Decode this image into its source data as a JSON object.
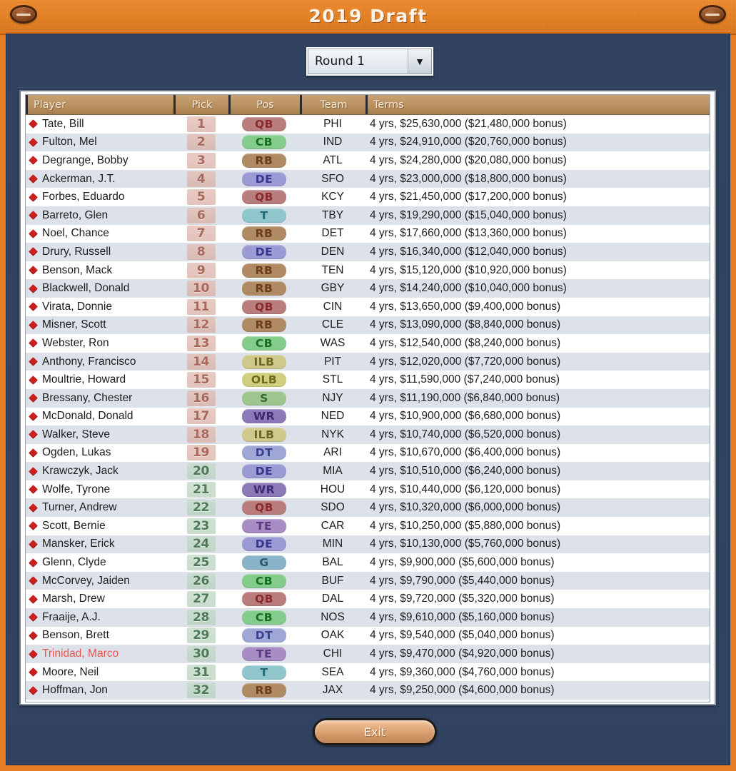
{
  "window": {
    "title": "2019 Draft",
    "minimize_left_icon": "football-icon",
    "minimize_right_icon": "football-icon"
  },
  "round_select": {
    "value": "Round 1",
    "arrow": "▼"
  },
  "table": {
    "columns": [
      "Player",
      "Pick",
      "Pos",
      "Team",
      "Terms"
    ],
    "rows": [
      {
        "player": "Tate, Bill",
        "pick": "1",
        "pos": "QB",
        "team": "PHI",
        "terms": "4 yrs, $25,630,000 ($21,480,000 bonus)",
        "highlight": false
      },
      {
        "player": "Fulton, Mel",
        "pick": "2",
        "pos": "CB",
        "team": "IND",
        "terms": "4 yrs, $24,910,000 ($20,760,000 bonus)",
        "highlight": false
      },
      {
        "player": "Degrange, Bobby",
        "pick": "3",
        "pos": "RB",
        "team": "ATL",
        "terms": "4 yrs, $24,280,000 ($20,080,000 bonus)",
        "highlight": false
      },
      {
        "player": "Ackerman, J.T.",
        "pick": "4",
        "pos": "DE",
        "team": "SFO",
        "terms": "4 yrs, $23,000,000 ($18,800,000 bonus)",
        "highlight": false
      },
      {
        "player": "Forbes, Eduardo",
        "pick": "5",
        "pos": "QB",
        "team": "KCY",
        "terms": "4 yrs, $21,450,000 ($17,200,000 bonus)",
        "highlight": false
      },
      {
        "player": "Barreto, Glen",
        "pick": "6",
        "pos": "T",
        "team": "TBY",
        "terms": "4 yrs, $19,290,000 ($15,040,000 bonus)",
        "highlight": false
      },
      {
        "player": "Noel, Chance",
        "pick": "7",
        "pos": "RB",
        "team": "DET",
        "terms": "4 yrs, $17,660,000 ($13,360,000 bonus)",
        "highlight": false
      },
      {
        "player": "Drury, Russell",
        "pick": "8",
        "pos": "DE",
        "team": "DEN",
        "terms": "4 yrs, $16,340,000 ($12,040,000 bonus)",
        "highlight": false
      },
      {
        "player": "Benson, Mack",
        "pick": "9",
        "pos": "RB",
        "team": "TEN",
        "terms": "4 yrs, $15,120,000 ($10,920,000 bonus)",
        "highlight": false
      },
      {
        "player": "Blackwell, Donald",
        "pick": "10",
        "pos": "RB",
        "team": "GBY",
        "terms": "4 yrs, $14,240,000 ($10,040,000 bonus)",
        "highlight": false
      },
      {
        "player": "Virata, Donnie",
        "pick": "11",
        "pos": "QB",
        "team": "CIN",
        "terms": "4 yrs, $13,650,000 ($9,400,000 bonus)",
        "highlight": false
      },
      {
        "player": "Misner, Scott",
        "pick": "12",
        "pos": "RB",
        "team": "CLE",
        "terms": "4 yrs, $13,090,000 ($8,840,000 bonus)",
        "highlight": false
      },
      {
        "player": "Webster, Ron",
        "pick": "13",
        "pos": "CB",
        "team": "WAS",
        "terms": "4 yrs, $12,540,000 ($8,240,000 bonus)",
        "highlight": false
      },
      {
        "player": "Anthony, Francisco",
        "pick": "14",
        "pos": "ILB",
        "team": "PIT",
        "terms": "4 yrs, $12,020,000 ($7,720,000 bonus)",
        "highlight": false
      },
      {
        "player": "Moultrie, Howard",
        "pick": "15",
        "pos": "OLB",
        "team": "STL",
        "terms": "4 yrs, $11,590,000 ($7,240,000 bonus)",
        "highlight": false
      },
      {
        "player": "Bressany, Chester",
        "pick": "16",
        "pos": "S",
        "team": "NJY",
        "terms": "4 yrs, $11,190,000 ($6,840,000 bonus)",
        "highlight": false
      },
      {
        "player": "McDonald, Donald",
        "pick": "17",
        "pos": "WR",
        "team": "NED",
        "terms": "4 yrs, $10,900,000 ($6,680,000 bonus)",
        "highlight": false
      },
      {
        "player": "Walker, Steve",
        "pick": "18",
        "pos": "ILB",
        "team": "NYK",
        "terms": "4 yrs, $10,740,000 ($6,520,000 bonus)",
        "highlight": false
      },
      {
        "player": "Ogden, Lukas",
        "pick": "19",
        "pos": "DT",
        "team": "ARI",
        "terms": "4 yrs, $10,670,000 ($6,400,000 bonus)",
        "highlight": false
      },
      {
        "player": "Krawczyk, Jack",
        "pick": "20",
        "pos": "DE",
        "team": "MIA",
        "terms": "4 yrs, $10,510,000 ($6,240,000 bonus)",
        "highlight": false
      },
      {
        "player": "Wolfe, Tyrone",
        "pick": "21",
        "pos": "WR",
        "team": "HOU",
        "terms": "4 yrs, $10,440,000 ($6,120,000 bonus)",
        "highlight": false
      },
      {
        "player": "Turner, Andrew",
        "pick": "22",
        "pos": "QB",
        "team": "SDO",
        "terms": "4 yrs, $10,320,000 ($6,000,000 bonus)",
        "highlight": false
      },
      {
        "player": "Scott, Bernie",
        "pick": "23",
        "pos": "TE",
        "team": "CAR",
        "terms": "4 yrs, $10,250,000 ($5,880,000 bonus)",
        "highlight": false
      },
      {
        "player": "Mansker, Erick",
        "pick": "24",
        "pos": "DE",
        "team": "MIN",
        "terms": "4 yrs, $10,130,000 ($5,760,000 bonus)",
        "highlight": false
      },
      {
        "player": "Glenn, Clyde",
        "pick": "25",
        "pos": "G",
        "team": "BAL",
        "terms": "4 yrs, $9,900,000 ($5,600,000 bonus)",
        "highlight": false
      },
      {
        "player": "McCorvey, Jaiden",
        "pick": "26",
        "pos": "CB",
        "team": "BUF",
        "terms": "4 yrs, $9,790,000 ($5,440,000 bonus)",
        "highlight": false
      },
      {
        "player": "Marsh, Drew",
        "pick": "27",
        "pos": "QB",
        "team": "DAL",
        "terms": "4 yrs, $9,720,000 ($5,320,000 bonus)",
        "highlight": false
      },
      {
        "player": "Fraaije, A.J.",
        "pick": "28",
        "pos": "CB",
        "team": "NOS",
        "terms": "4 yrs, $9,610,000 ($5,160,000 bonus)",
        "highlight": false
      },
      {
        "player": "Benson, Brett",
        "pick": "29",
        "pos": "DT",
        "team": "OAK",
        "terms": "4 yrs, $9,540,000 ($5,040,000 bonus)",
        "highlight": false
      },
      {
        "player": "Trinidad, Marco",
        "pick": "30",
        "pos": "TE",
        "team": "CHI",
        "terms": "4 yrs, $9,470,000 ($4,920,000 bonus)",
        "highlight": true
      },
      {
        "player": "Moore, Neil",
        "pick": "31",
        "pos": "T",
        "team": "SEA",
        "terms": "4 yrs, $9,360,000 ($4,760,000 bonus)",
        "highlight": false
      },
      {
        "player": "Hoffman, Jon",
        "pick": "32",
        "pos": "RB",
        "team": "JAX",
        "terms": "4 yrs, $9,250,000 ($4,600,000 bonus)",
        "highlight": false
      }
    ]
  },
  "footer": {
    "exit_label": "Exit"
  },
  "colors": {
    "title_bar": "#e8801f",
    "body_panel": "#2e4160",
    "header_row": "#b98f5c",
    "row_alt": "#dde2ea",
    "highlight_text": "#e8554e",
    "diamond": "#cc1f1f",
    "pos": {
      "QB": {
        "bg": "#b97d7d",
        "fg": "#8a2a2a"
      },
      "RB": {
        "bg": "#b08a63",
        "fg": "#6b3d18"
      },
      "WR": {
        "bg": "#8b79b8",
        "fg": "#3c2a72"
      },
      "TE": {
        "bg": "#a88dc4",
        "fg": "#5b3a84"
      },
      "T": {
        "bg": "#8ec6cc",
        "fg": "#1d6a74"
      },
      "G": {
        "bg": "#89b3c9",
        "fg": "#28566f"
      },
      "C": {
        "bg": "#89b3c9",
        "fg": "#28566f"
      },
      "DE": {
        "bg": "#9b9ad4",
        "fg": "#3b338c"
      },
      "DT": {
        "bg": "#9fa7d6",
        "fg": "#39418f"
      },
      "ILB": {
        "bg": "#cfc98b",
        "fg": "#6d6621"
      },
      "OLB": {
        "bg": "#cfcf7f",
        "fg": "#6b6b18"
      },
      "S": {
        "bg": "#9ec58e",
        "fg": "#2f6b2b"
      },
      "CB": {
        "bg": "#84cc8c",
        "fg": "#16701f"
      }
    }
  }
}
